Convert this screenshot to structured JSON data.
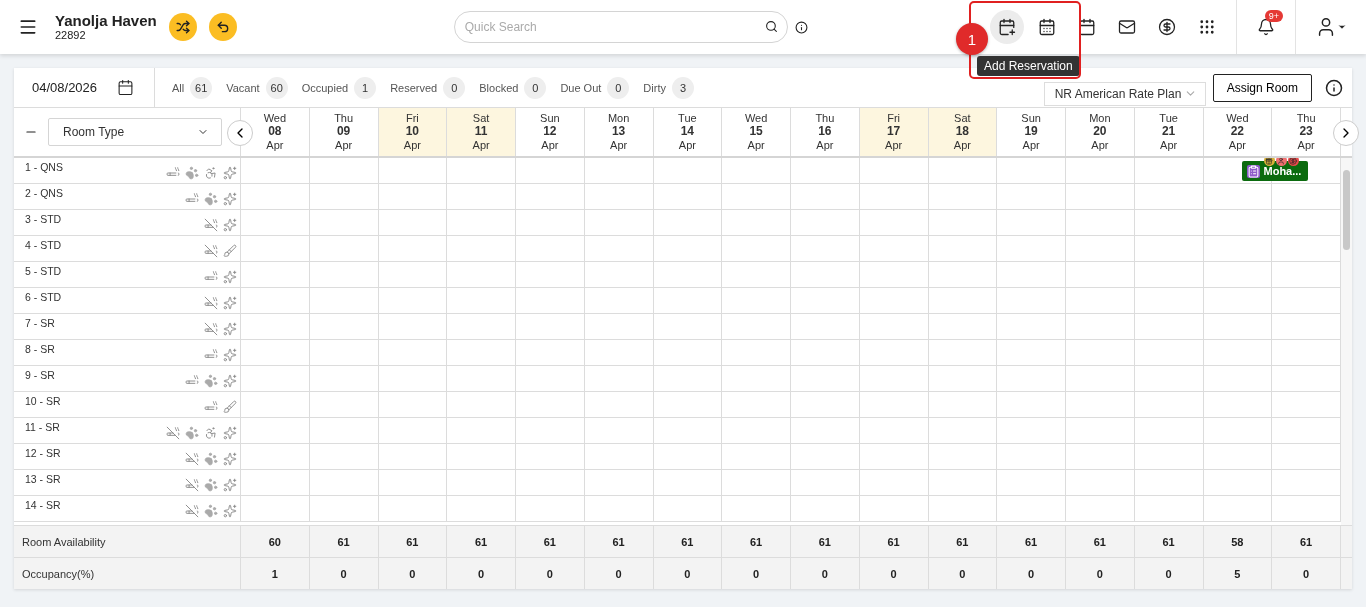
{
  "header": {
    "property_name": "Yanolja Haven",
    "property_code": "22892",
    "search": {
      "placeholder": "Quick Search"
    },
    "actions": [
      {
        "kind": "add-reservation",
        "highlighted": true,
        "tooltip": "Add Reservation"
      },
      {
        "kind": "calendar-list",
        "highlighted": false
      },
      {
        "kind": "calendar",
        "highlighted": false
      },
      {
        "kind": "mail",
        "highlighted": false
      },
      {
        "kind": "dollar",
        "highlighted": false
      },
      {
        "kind": "apps",
        "highlighted": false
      }
    ],
    "notifications": {
      "badge": "9+"
    }
  },
  "annotation": {
    "step": "1"
  },
  "toolbar": {
    "date": "04/08/2026",
    "filters": [
      {
        "label": "All",
        "count": "61"
      },
      {
        "label": "Vacant",
        "count": "60"
      },
      {
        "label": "Occupied",
        "count": "1"
      },
      {
        "label": "Reserved",
        "count": "0"
      },
      {
        "label": "Blocked",
        "count": "0"
      },
      {
        "label": "Due Out",
        "count": "0"
      },
      {
        "label": "Dirty",
        "count": "3"
      }
    ],
    "rate_plan": "NR American Rate Plan",
    "assign_button": "Assign Room"
  },
  "grid": {
    "group_by": "Room Type",
    "days": [
      {
        "weekday": "Wed",
        "day": "08",
        "month": "Apr",
        "highlighted": false
      },
      {
        "weekday": "Thu",
        "day": "09",
        "month": "Apr",
        "highlighted": false
      },
      {
        "weekday": "Fri",
        "day": "10",
        "month": "Apr",
        "highlighted": true
      },
      {
        "weekday": "Sat",
        "day": "11",
        "month": "Apr",
        "highlighted": true
      },
      {
        "weekday": "Sun",
        "day": "12",
        "month": "Apr",
        "highlighted": false
      },
      {
        "weekday": "Mon",
        "day": "13",
        "month": "Apr",
        "highlighted": false
      },
      {
        "weekday": "Tue",
        "day": "14",
        "month": "Apr",
        "highlighted": false
      },
      {
        "weekday": "Wed",
        "day": "15",
        "month": "Apr",
        "highlighted": false
      },
      {
        "weekday": "Thu",
        "day": "16",
        "month": "Apr",
        "highlighted": false
      },
      {
        "weekday": "Fri",
        "day": "17",
        "month": "Apr",
        "highlighted": true
      },
      {
        "weekday": "Sat",
        "day": "18",
        "month": "Apr",
        "highlighted": true
      },
      {
        "weekday": "Sun",
        "day": "19",
        "month": "Apr",
        "highlighted": false
      },
      {
        "weekday": "Mon",
        "day": "20",
        "month": "Apr",
        "highlighted": false
      },
      {
        "weekday": "Tue",
        "day": "21",
        "month": "Apr",
        "highlighted": false
      },
      {
        "weekday": "Wed",
        "day": "22",
        "month": "Apr",
        "highlighted": false
      },
      {
        "weekday": "Thu",
        "day": "23",
        "month": "Apr",
        "highlighted": false
      }
    ],
    "rooms": [
      {
        "name": "1 - QNS",
        "features": [
          {
            "kind": "smoking"
          },
          {
            "kind": "pet"
          },
          {
            "kind": "accessible"
          },
          {
            "kind": "clean"
          }
        ],
        "reservation": {
          "label": "Moha..."
        }
      },
      {
        "name": "2 - QNS",
        "features": [
          {
            "kind": "smoking"
          },
          {
            "kind": "pet"
          },
          {
            "kind": "clean"
          }
        ]
      },
      {
        "name": "3 - STD",
        "features": [
          {
            "kind": "non-smoking"
          },
          {
            "kind": "clean"
          }
        ]
      },
      {
        "name": "4 - STD",
        "features": [
          {
            "kind": "non-smoking"
          },
          {
            "kind": "dirty"
          }
        ]
      },
      {
        "name": "5 - STD",
        "features": [
          {
            "kind": "smoking"
          },
          {
            "kind": "clean"
          }
        ]
      },
      {
        "name": "6 - STD",
        "features": [
          {
            "kind": "non-smoking"
          },
          {
            "kind": "clean"
          }
        ]
      },
      {
        "name": "7 - SR",
        "features": [
          {
            "kind": "non-smoking"
          },
          {
            "kind": "clean"
          }
        ]
      },
      {
        "name": "8 - SR",
        "features": [
          {
            "kind": "smoking"
          },
          {
            "kind": "clean"
          }
        ]
      },
      {
        "name": "9 - SR",
        "features": [
          {
            "kind": "smoking"
          },
          {
            "kind": "pet"
          },
          {
            "kind": "clean"
          }
        ]
      },
      {
        "name": "10 - SR",
        "features": [
          {
            "kind": "smoking"
          },
          {
            "kind": "dirty"
          }
        ]
      },
      {
        "name": "11 - SR",
        "features": [
          {
            "kind": "non-smoking"
          },
          {
            "kind": "pet"
          },
          {
            "kind": "accessible"
          },
          {
            "kind": "clean"
          }
        ]
      },
      {
        "name": "12 - SR",
        "features": [
          {
            "kind": "non-smoking"
          },
          {
            "kind": "pet"
          },
          {
            "kind": "clean"
          }
        ]
      },
      {
        "name": "13 - SR",
        "features": [
          {
            "kind": "non-smoking"
          },
          {
            "kind": "pet"
          },
          {
            "kind": "clean"
          }
        ]
      },
      {
        "name": "14 - SR",
        "features": [
          {
            "kind": "non-smoking"
          },
          {
            "kind": "pet"
          },
          {
            "kind": "clean"
          }
        ]
      }
    ],
    "summary": [
      {
        "label": "Room Availability",
        "values": [
          "60",
          "61",
          "61",
          "61",
          "61",
          "61",
          "61",
          "61",
          "61",
          "61",
          "61",
          "61",
          "61",
          "61",
          "58",
          "61"
        ]
      },
      {
        "label": "Occupancy(%)",
        "values": [
          "1",
          "0",
          "0",
          "0",
          "0",
          "0",
          "0",
          "0",
          "0",
          "0",
          "0",
          "0",
          "0",
          "0",
          "5",
          "0"
        ]
      }
    ]
  }
}
